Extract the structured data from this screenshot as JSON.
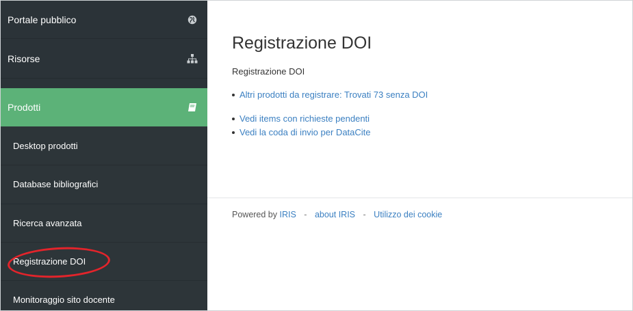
{
  "sidebar": {
    "nav": [
      {
        "label": "Portale pubblico",
        "icon": "globe-icon"
      },
      {
        "label": "Risorse",
        "icon": "sitemap-icon"
      },
      {
        "label": "Prodotti",
        "icon": "book-icon"
      }
    ],
    "sub_items": [
      {
        "label": "Desktop prodotti"
      },
      {
        "label": "Database bibliografici"
      },
      {
        "label": "Ricerca avanzata"
      },
      {
        "label": "Registrazione DOI"
      },
      {
        "label": "Monitoraggio sito docente"
      }
    ]
  },
  "main": {
    "title": "Registrazione DOI",
    "subtitle": "Registrazione DOI",
    "links_group1": [
      "Altri prodotti da registrare: Trovati 73 senza DOI"
    ],
    "links_group2": [
      "Vedi items con richieste pendenti",
      "Vedi la coda di invio per DataCite"
    ]
  },
  "footer": {
    "powered_by": "Powered by",
    "iris_link": "IRIS",
    "separator": "-",
    "about_link": "about IRIS",
    "cookie_link": "Utilizzo dei cookie"
  },
  "colors": {
    "sidebar_bg": "#2b3338",
    "active_bg": "#5cb278",
    "link": "#3a7fc1",
    "highlight": "#e3242b"
  }
}
